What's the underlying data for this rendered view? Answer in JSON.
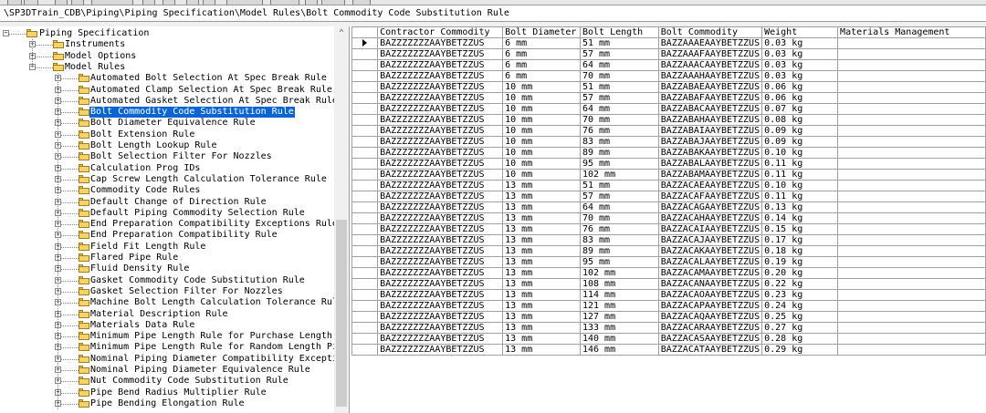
{
  "address": "\\SP3DTrain_CDB\\Piping\\Piping Specification\\Model Rules\\Bolt Commodity Code Substitution Rule",
  "tree": {
    "root": "Piping Specification",
    "level1": [
      {
        "label": "Instruments",
        "expanded": false
      },
      {
        "label": "Model Options",
        "expanded": false
      },
      {
        "label": "Model Rules",
        "expanded": true
      }
    ],
    "rules": [
      "Automated Bolt Selection At Spec Break Rule",
      "Automated Clamp Selection At Spec Break Rule",
      "Automated Gasket Selection At Spec Break Rule",
      "Bolt Commodity Code Substitution Rule",
      "Bolt Diameter Equivalence Rule",
      "Bolt Extension Rule",
      "Bolt Length Lookup Rule",
      "Bolt Selection Filter For Nozzles",
      "Calculation Prog IDs",
      "Cap Screw Length Calculation Tolerance Rule",
      "Commodity Code Rules",
      "Default Change of Direction Rule",
      "Default Piping Commodity Selection Rule",
      "End Preparation Compatibility Exceptions Rule",
      "End Preparation Compatibility Rule",
      "Field Fit Length Rule",
      "Flared Pipe Rule",
      "Fluid Density Rule",
      "Gasket Commodity Code Substitution Rule",
      "Gasket Selection Filter For Nozzles",
      "Machine Bolt Length Calculation Tolerance Rule",
      "Material Description Rule",
      "Materials Data Rule",
      "Minimum Pipe Length Rule for Purchase Length Pipe",
      "Minimum Pipe Length Rule for Random Length Pipe",
      "Nominal Piping Diameter Compatibility Exceptions",
      "Nominal Piping Diameter Equivalence Rule",
      "Nut Commodity Code Substitution Rule",
      "Pipe Bend Radius Multiplier Rule",
      "Pipe Bending Elongation Rule"
    ],
    "selected_index": 3
  },
  "grid": {
    "columns": [
      "Contractor Commodity",
      "Bolt Diameter",
      "Bolt Length",
      "Bolt Commodity",
      "Weight",
      "Materials Management"
    ],
    "rows": [
      [
        "BAZZZZZZZAAYBETZZUS",
        "6 mm",
        "51 mm",
        "BAZZAAAEAAYBETZZUS",
        "0.03 kg",
        ""
      ],
      [
        "BAZZZZZZZAAYBETZZUS",
        "6 mm",
        "57 mm",
        "BAZZAAAFAAYBETZZUS",
        "0.03 kg",
        ""
      ],
      [
        "BAZZZZZZZAAYBETZZUS",
        "6 mm",
        "64 mm",
        "BAZZAAACAAYBETZZUS",
        "0.03 kg",
        ""
      ],
      [
        "BAZZZZZZZAAYBETZZUS",
        "6 mm",
        "70 mm",
        "BAZZAAAHAAYBETZZUS",
        "0.03 kg",
        ""
      ],
      [
        "BAZZZZZZZAAYBETZZUS",
        "10 mm",
        "51 mm",
        "BAZZABAEAAYBETZZUS",
        "0.06 kg",
        ""
      ],
      [
        "BAZZZZZZZAAYBETZZUS",
        "10 mm",
        "57 mm",
        "BAZZABAFAAYBETZZUS",
        "0.06 kg",
        ""
      ],
      [
        "BAZZZZZZZAAYBETZZUS",
        "10 mm",
        "64 mm",
        "BAZZABACAAYBETZZUS",
        "0.07 kg",
        ""
      ],
      [
        "BAZZZZZZZAAYBETZZUS",
        "10 mm",
        "70 mm",
        "BAZZABAHAAYBETZZUS",
        "0.08 kg",
        ""
      ],
      [
        "BAZZZZZZZAAYBETZZUS",
        "10 mm",
        "76 mm",
        "BAZZABAIAAYBETZZUS",
        "0.09 kg",
        ""
      ],
      [
        "BAZZZZZZZAAYBETZZUS",
        "10 mm",
        "83 mm",
        "BAZZABAJAAYBETZZUS",
        "0.09 kg",
        ""
      ],
      [
        "BAZZZZZZZAAYBETZZUS",
        "10 mm",
        "89 mm",
        "BAZZABAKAAYBETZZUS",
        "0.10 kg",
        ""
      ],
      [
        "BAZZZZZZZAAYBETZZUS",
        "10 mm",
        "95 mm",
        "BAZZABALAAYBETZZUS",
        "0.11 kg",
        ""
      ],
      [
        "BAZZZZZZZAAYBETZZUS",
        "10 mm",
        "102 mm",
        "BAZZABAMAAYBETZZUS",
        "0.11 kg",
        ""
      ],
      [
        "BAZZZZZZZAAYBETZZUS",
        "13 mm",
        "51 mm",
        "BAZZACAEAAYBETZZUS",
        "0.10 kg",
        ""
      ],
      [
        "BAZZZZZZZAAYBETZZUS",
        "13 mm",
        "57 mm",
        "BAZZACAFAAYBETZZUS",
        "0.11 kg",
        ""
      ],
      [
        "BAZZZZZZZAAYBETZZUS",
        "13 mm",
        "64 mm",
        "BAZZACAGAAYBETZZUS",
        "0.13 kg",
        ""
      ],
      [
        "BAZZZZZZZAAYBETZZUS",
        "13 mm",
        "70 mm",
        "BAZZACAHAAYBETZZUS",
        "0.14 kg",
        ""
      ],
      [
        "BAZZZZZZZAAYBETZZUS",
        "13 mm",
        "76 mm",
        "BAZZACAIAAYBETZZUS",
        "0.15 kg",
        ""
      ],
      [
        "BAZZZZZZZAAYBETZZUS",
        "13 mm",
        "83 mm",
        "BAZZACAJAAYBETZZUS",
        "0.17 kg",
        ""
      ],
      [
        "BAZZZZZZZAAYBETZZUS",
        "13 mm",
        "89 mm",
        "BAZZACAKAAYBETZZUS",
        "0.18 kg",
        ""
      ],
      [
        "BAZZZZZZZAAYBETZZUS",
        "13 mm",
        "95 mm",
        "BAZZACALAAYBETZZUS",
        "0.19 kg",
        ""
      ],
      [
        "BAZZZZZZZAAYBETZZUS",
        "13 mm",
        "102 mm",
        "BAZZACAMAAYBETZZUS",
        "0.20 kg",
        ""
      ],
      [
        "BAZZZZZZZAAYBETZZUS",
        "13 mm",
        "108 mm",
        "BAZZACANAAYBETZZUS",
        "0.22 kg",
        ""
      ],
      [
        "BAZZZZZZZAAYBETZZUS",
        "13 mm",
        "114 mm",
        "BAZZACAOAAYBETZZUS",
        "0.23 kg",
        ""
      ],
      [
        "BAZZZZZZZAAYBETZZUS",
        "13 mm",
        "121 mm",
        "BAZZACAPAAYBETZZUS",
        "0.24 kg",
        ""
      ],
      [
        "BAZZZZZZZAAYBETZZUS",
        "13 mm",
        "127 mm",
        "BAZZACAQAAYBETZZUS",
        "0.25 kg",
        ""
      ],
      [
        "BAZZZZZZZAAYBETZZUS",
        "13 mm",
        "133 mm",
        "BAZZACARAAYBETZZUS",
        "0.27 kg",
        ""
      ],
      [
        "BAZZZZZZZAAYBETZZUS",
        "13 mm",
        "140 mm",
        "BAZZACASAAYBETZZUS",
        "0.28 kg",
        ""
      ],
      [
        "BAZZZZZZZAAYBETZZUS",
        "13 mm",
        "146 mm",
        "BAZZACATAAYBETZZUS",
        "0.29 kg",
        ""
      ]
    ],
    "current_row": 0
  },
  "icons": {
    "expander_collapsed": "plus-box-icon",
    "expander_expanded": "minus-box-icon",
    "folder": "folder-icon",
    "row_pointer": "current-row-pointer-icon",
    "scroll_up": "chevron-up-icon"
  },
  "colors": {
    "selection": "#0a64d2",
    "grid_border": "#a0a0a0",
    "folder": "#f5d36a"
  }
}
